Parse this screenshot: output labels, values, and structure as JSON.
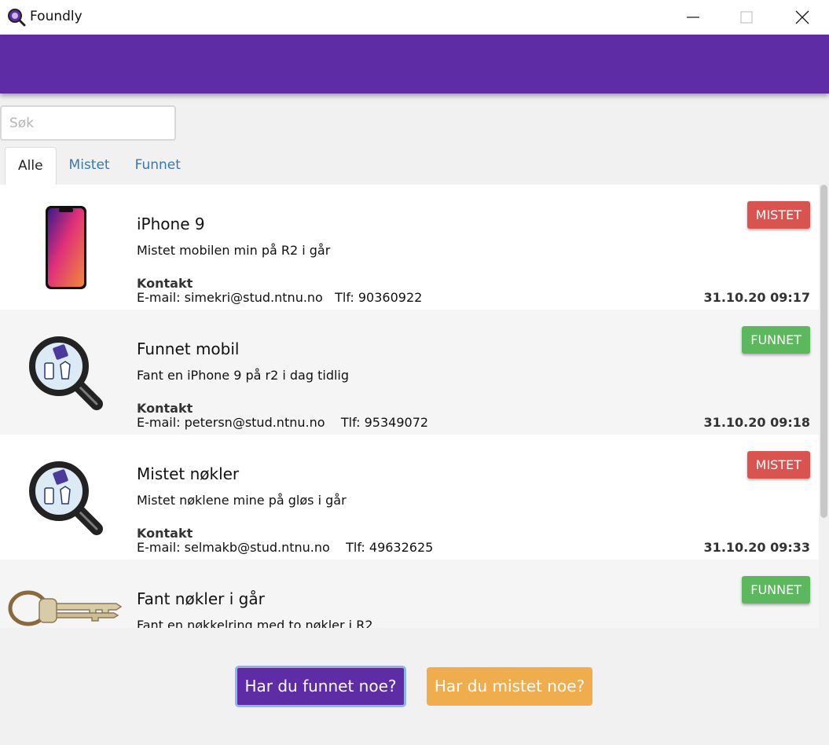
{
  "window": {
    "title": "Foundly",
    "controls": [
      "minimize-icon",
      "maximize-icon",
      "close-icon"
    ]
  },
  "colors": {
    "brand_purple": "#5e2ca5",
    "lost_red": "#d9534f",
    "found_green": "#5cb85c",
    "lost_button_orange": "#f0ad4e",
    "tab_link_blue": "#3a78b0"
  },
  "search": {
    "placeholder": "Søk",
    "value": ""
  },
  "tabs": [
    {
      "label": "Alle",
      "active": true
    },
    {
      "label": "Mistet",
      "active": false
    },
    {
      "label": "Funnet",
      "active": false
    }
  ],
  "posts": [
    {
      "title": "iPhone 9",
      "description": "Mistet mobilen min på R2 i går",
      "contact_label": "Kontakt",
      "email": "E-mail: simekri@stud.ntnu.no",
      "phone": "Tlf: 90360922",
      "timestamp": "31.10.20 09:17",
      "status": "MISTET",
      "image": "phone-image"
    },
    {
      "title": "Funnet mobil",
      "description": "Fant en iPhone 9 på r2 i dag tidlig",
      "contact_label": "Kontakt",
      "email": "E-mail: petersn@stud.ntnu.no",
      "phone": "Tlf: 95349072",
      "timestamp": "31.10.20 09:18",
      "status": "FUNNET",
      "image": "magnifier-placeholder-icon"
    },
    {
      "title": "Mistet nøkler",
      "description": "Mistet nøklene mine på gløs i går",
      "contact_label": "Kontakt",
      "email": "E-mail: selmakb@stud.ntnu.no",
      "phone": "Tlf: 49632625",
      "timestamp": "31.10.20 09:33",
      "status": "MISTET",
      "image": "magnifier-placeholder-icon"
    },
    {
      "title": "Fant nøkler i går",
      "description": "Fant en nøkkelring med to nøkler i R2",
      "status": "FUNNET",
      "image": "keys-image"
    }
  ],
  "buttons": {
    "found": "Har du funnet noe?",
    "lost": "Har du mistet noe?"
  }
}
